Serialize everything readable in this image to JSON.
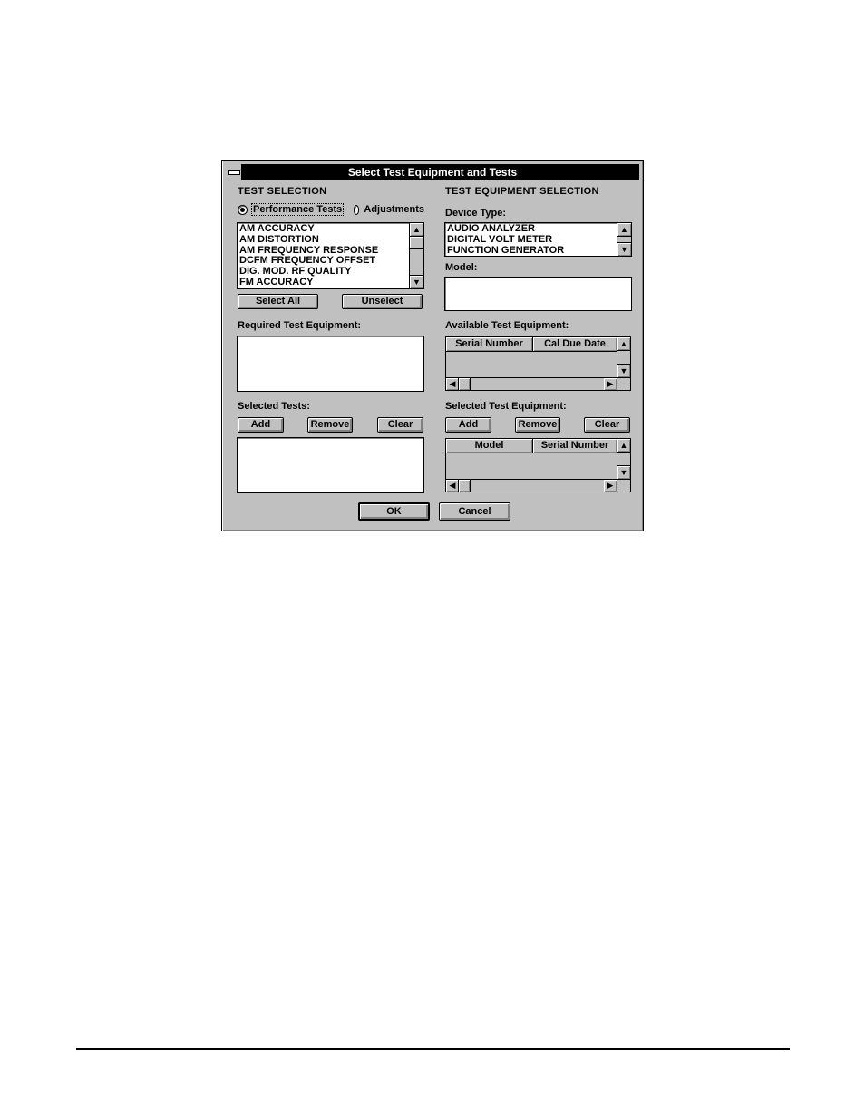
{
  "dialog": {
    "title": "Select Test Equipment and Tests",
    "ok_label": "OK",
    "cancel_label": "Cancel"
  },
  "test_selection": {
    "heading": "TEST SELECTION",
    "radio_options": [
      {
        "label": "Performance Tests",
        "selected": true
      },
      {
        "label": "Adjustments",
        "selected": false
      }
    ],
    "tests_list": [
      "AM ACCURACY",
      "AM DISTORTION",
      "AM FREQUENCY RESPONSE",
      "DCFM FREQUENCY OFFSET",
      "DIG. MOD. RF QUALITY",
      "FM ACCURACY"
    ],
    "select_all_label": "Select All",
    "unselect_label": "Unselect",
    "required_equipment_label": "Required Test Equipment:",
    "required_equipment_items": [],
    "selected_tests_label": "Selected Tests:",
    "add_label": "Add",
    "remove_label": "Remove",
    "clear_label": "Clear",
    "selected_tests_items": []
  },
  "equipment_selection": {
    "heading": "TEST EQUIPMENT SELECTION",
    "device_type_label": "Device Type:",
    "device_types": [
      "AUDIO ANALYZER",
      "DIGITAL VOLT METER",
      "FUNCTION GENERATOR"
    ],
    "model_label": "Model:",
    "model_items": [],
    "available_label": "Available Test Equipment:",
    "available_columns": [
      "Serial Number",
      "Cal Due Date"
    ],
    "available_rows": [],
    "selected_label": "Selected Test Equipment:",
    "add_label": "Add",
    "remove_label": "Remove",
    "clear_label": "Clear",
    "selected_columns": [
      "Model",
      "Serial Number"
    ],
    "selected_rows": []
  },
  "icons": {
    "up": "▲",
    "down": "▼",
    "left": "◀",
    "right": "▶"
  }
}
